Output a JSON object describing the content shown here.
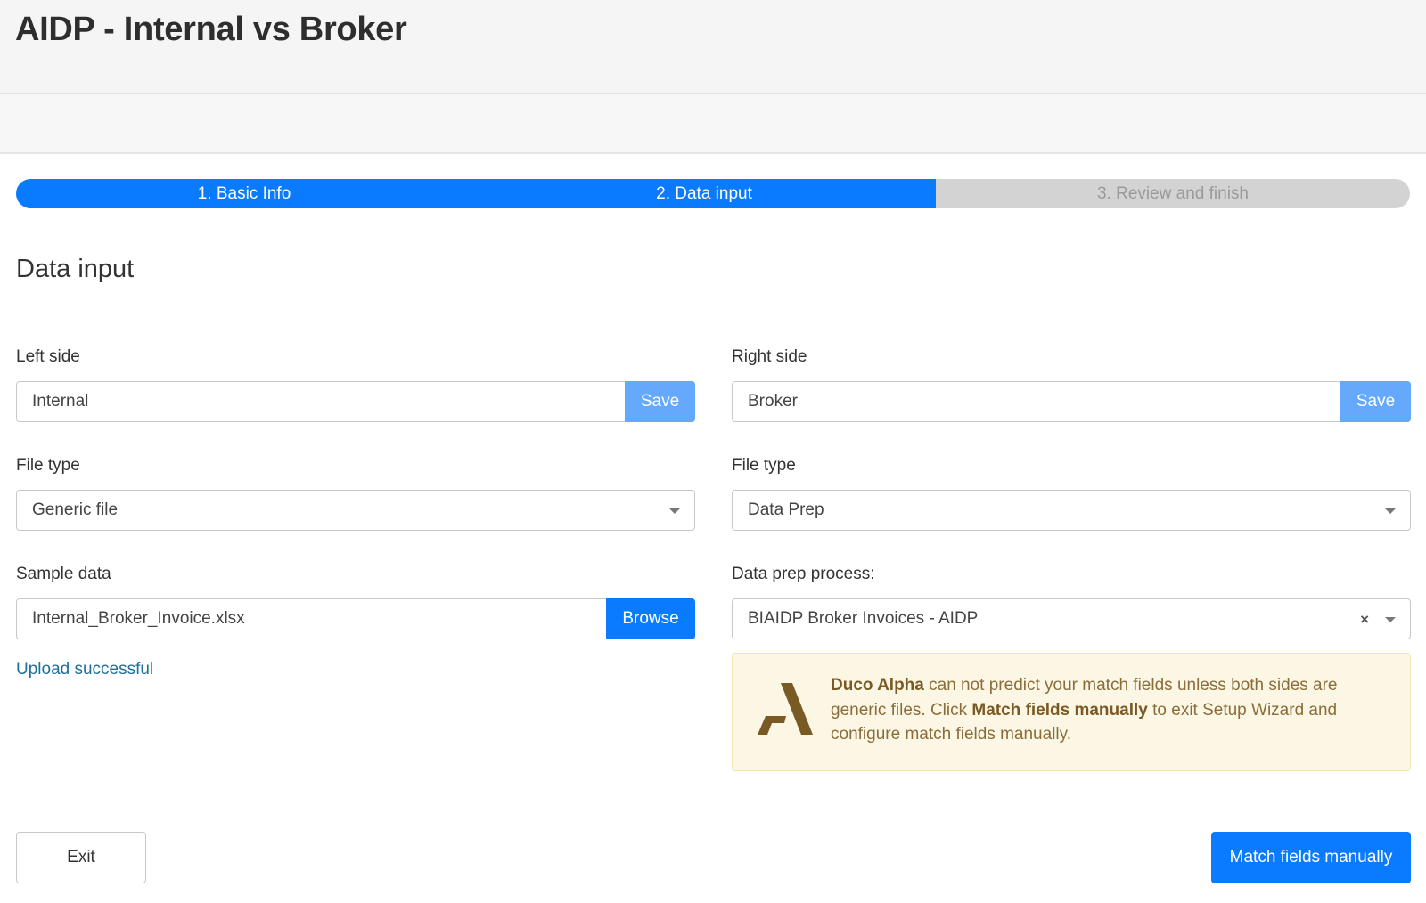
{
  "header": {
    "title": "AIDP - Internal vs Broker"
  },
  "wizard": {
    "progress_fraction": 0.66,
    "steps": [
      {
        "label": "1. Basic Info",
        "state": "complete"
      },
      {
        "label": "2. Data input",
        "state": "active"
      },
      {
        "label": "3. Review and finish",
        "state": "inactive"
      }
    ]
  },
  "main": {
    "section_title": "Data input"
  },
  "left": {
    "side_label": "Left side",
    "side_value": "Internal",
    "save_label": "Save",
    "file_type_label": "File type",
    "file_type_value": "Generic file",
    "sample_label": "Sample data",
    "sample_value": "Internal_Broker_Invoice.xlsx",
    "browse_label": "Browse",
    "upload_status": "Upload successful"
  },
  "right": {
    "side_label": "Right side",
    "side_value": "Broker",
    "save_label": "Save",
    "file_type_label": "File type",
    "file_type_value": "Data Prep",
    "process_label": "Data prep process:",
    "process_value": "BIAIDP Broker Invoices - AIDP",
    "clear_glyph": "×"
  },
  "alert": {
    "brand": "Duco Alpha",
    "text1": " can not predict your match fields unless both sides are generic files. Click ",
    "emphasis": "Match fields manually",
    "text2": " to exit Setup Wizard and configure match fields manually."
  },
  "footer": {
    "exit_label": "Exit",
    "match_label": "Match fields manually"
  },
  "colors": {
    "primary": "#0a7bff",
    "primary_light": "#64a9fb",
    "progress_track": "#d3d3d3",
    "alert_bg": "#fcf7e4",
    "alert_text": "#8a6d3b",
    "logo_brown": "#7a5a24",
    "link": "#1f6f99"
  }
}
